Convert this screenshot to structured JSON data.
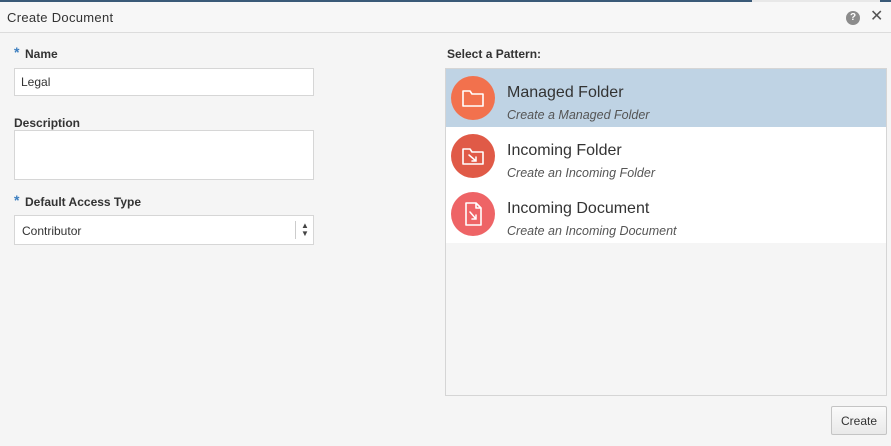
{
  "dialog": {
    "title": "Create Document",
    "help_glyph": "?",
    "close_glyph": "✕"
  },
  "colors": {
    "required_star": "#3c7ebf",
    "selected_row": "#bfd3e4",
    "managed_icon": "#f2714d",
    "incoming_folder_icon": "#e05a47",
    "incoming_document_icon": "#ee6466"
  },
  "form": {
    "required_marker": "*",
    "name": {
      "label": "Name",
      "value": "Legal"
    },
    "description": {
      "label": "Description",
      "value": ""
    },
    "access_type": {
      "label": "Default Access Type",
      "value": "Contributor"
    }
  },
  "patterns": {
    "label": "Select a Pattern:",
    "items": [
      {
        "title": "Managed Folder",
        "subtitle": "Create a Managed Folder",
        "icon": "folder-icon",
        "selected": true
      },
      {
        "title": "Incoming Folder",
        "subtitle": "Create an Incoming Folder",
        "icon": "incoming-folder-icon",
        "selected": false
      },
      {
        "title": "Incoming Document",
        "subtitle": "Create an Incoming Document",
        "icon": "incoming-document-icon",
        "selected": false
      }
    ]
  },
  "actions": {
    "create_label": "Create"
  }
}
